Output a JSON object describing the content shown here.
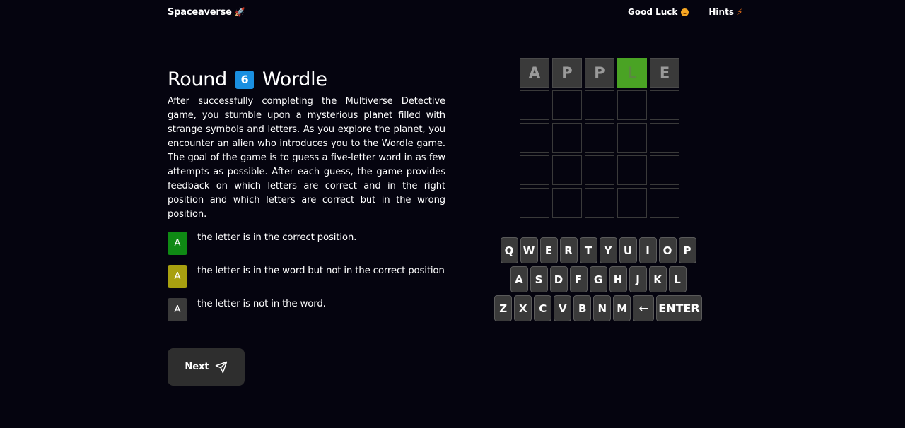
{
  "nav": {
    "brand": "Spaceaverse",
    "brand_icon": "rocket-icon",
    "good_luck": "Good Luck",
    "good_luck_icon": "smiley-icon",
    "hints": "Hints",
    "hints_icon": "lightning-icon"
  },
  "content": {
    "title_prefix": "Round",
    "round_number": "6",
    "title_suffix": "Wordle",
    "description": "After successfully completing the Multiverse Detective game, you stumble upon a mysterious planet filled with strange symbols and letters. As you explore the planet, you encounter an alien who introduces you to the Wordle game. The goal of the game is to guess a five-letter word in as few attempts as possible. After each guess, the game provides feedback on which letters are correct and in the right position and which letters are correct but in the wrong position.",
    "legend": [
      {
        "letter": "A",
        "color": "#0f8a14",
        "text": "the letter is in the correct position."
      },
      {
        "letter": "A",
        "color": "#a8a010",
        "text": "the letter is in the word but not in the correct position"
      },
      {
        "letter": "A",
        "color": "#3a3a3a",
        "text": "the letter is not in the word."
      }
    ],
    "next_label": "Next",
    "next_icon": "send-icon"
  },
  "board": {
    "rows": [
      [
        {
          "letter": "A",
          "state": "filled"
        },
        {
          "letter": "P",
          "state": "filled"
        },
        {
          "letter": "P",
          "state": "filled"
        },
        {
          "letter": "L",
          "state": "correct"
        },
        {
          "letter": "E",
          "state": "filled"
        }
      ],
      [
        {
          "letter": "",
          "state": "empty"
        },
        {
          "letter": "",
          "state": "empty"
        },
        {
          "letter": "",
          "state": "empty"
        },
        {
          "letter": "",
          "state": "empty"
        },
        {
          "letter": "",
          "state": "empty"
        }
      ],
      [
        {
          "letter": "",
          "state": "empty"
        },
        {
          "letter": "",
          "state": "empty"
        },
        {
          "letter": "",
          "state": "empty"
        },
        {
          "letter": "",
          "state": "empty"
        },
        {
          "letter": "",
          "state": "empty"
        }
      ],
      [
        {
          "letter": "",
          "state": "empty"
        },
        {
          "letter": "",
          "state": "empty"
        },
        {
          "letter": "",
          "state": "empty"
        },
        {
          "letter": "",
          "state": "empty"
        },
        {
          "letter": "",
          "state": "empty"
        }
      ],
      [
        {
          "letter": "",
          "state": "empty"
        },
        {
          "letter": "",
          "state": "empty"
        },
        {
          "letter": "",
          "state": "empty"
        },
        {
          "letter": "",
          "state": "empty"
        },
        {
          "letter": "",
          "state": "empty"
        }
      ]
    ]
  },
  "keyboard": {
    "rows": [
      [
        "Q",
        "W",
        "E",
        "R",
        "T",
        "Y",
        "U",
        "I",
        "O",
        "P"
      ],
      [
        "A",
        "S",
        "D",
        "F",
        "G",
        "H",
        "J",
        "K",
        "L"
      ],
      [
        "Z",
        "X",
        "C",
        "V",
        "B",
        "N",
        "M",
        "←",
        "ENTER"
      ]
    ]
  }
}
